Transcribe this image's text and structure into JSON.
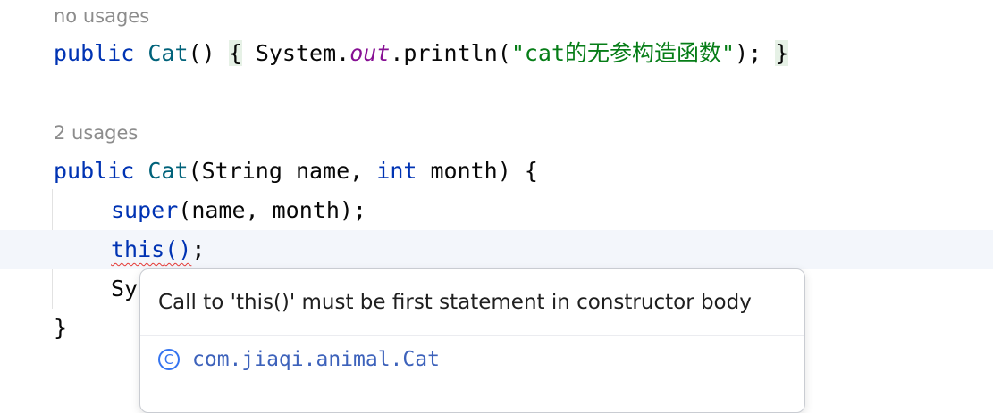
{
  "editor": {
    "hint1": "no usages",
    "hint2": "2 usages",
    "lines": {
      "l1": {
        "public": "public",
        "name": "Cat",
        "parens": "()",
        "open": "{",
        "system": " System.",
        "out": "out",
        "println": ".println(",
        "string": "\"cat的无参构造函数\"",
        "semi": ");",
        "close": "}"
      },
      "l2": {
        "public": "public",
        "name": "Cat",
        "open_paren": "(",
        "type": "String",
        "params1": " name, ",
        "int": "int",
        "params2": " month) {"
      },
      "l3": {
        "super": "super",
        "rest": "(name, month);"
      },
      "l4": {
        "this": "this",
        "parens": "()",
        "semi": ";"
      },
      "l5": {
        "text": "Sy"
      },
      "l6": {
        "brace": "}"
      }
    }
  },
  "popup": {
    "message": "Call to 'this()' must be first statement in constructor body",
    "class_icon": "C",
    "class_name": "com.jiaqi.animal.Cat"
  },
  "colors": {
    "keyword": "#0033b3",
    "function": "#00627a",
    "string": "#067d17",
    "static_field": "#871094",
    "error_underline": "#e53935",
    "link": "#3d62bb"
  }
}
